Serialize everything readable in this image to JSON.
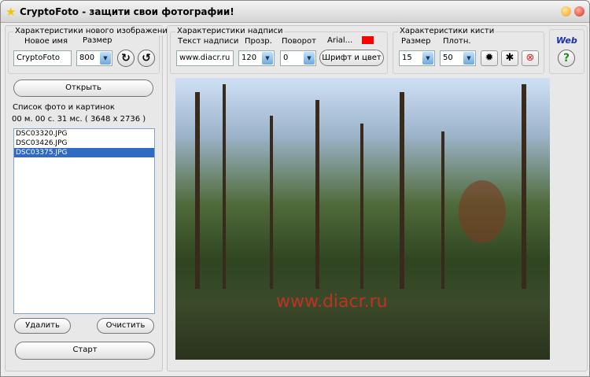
{
  "title": "CryptoFoto - защити свои фотографии!",
  "new_image": {
    "legend": "Характеристики нового изображения",
    "name_label": "Новое имя",
    "name_value": "CryptoFoto",
    "size_label": "Размер",
    "size_value": "800"
  },
  "open_label": "Открыть",
  "list": {
    "legend": "Список фото и картинок",
    "status": "00 м. 00 с. 31 мс. ( 3648 x 2736 )",
    "items": [
      "DSC03320.JPG",
      "DSC03426.JPG",
      "DSC03375.JPG"
    ],
    "selected": 2
  },
  "delete_label": "Удалить",
  "clear_label": "Очистить",
  "start_label": "Старт",
  "caption": {
    "legend": "Характеристики надписи",
    "text_label": "Текст надписи",
    "text_value": "www.diacr.ru",
    "opacity_label": "Прозр.",
    "opacity_value": "120",
    "rotate_label": "Поворот",
    "rotate_value": "0",
    "font_label": "Arial...",
    "font_button": "Шрифт и цвет",
    "color": "#ff0000"
  },
  "brush": {
    "legend": "Характеристики кисти",
    "size_label": "Размер",
    "size_value": "15",
    "density_label": "Плотн.",
    "density_value": "50"
  },
  "web": {
    "label": "Web",
    "help": "?"
  },
  "photo": {
    "watermark": "www.diacr.ru"
  }
}
